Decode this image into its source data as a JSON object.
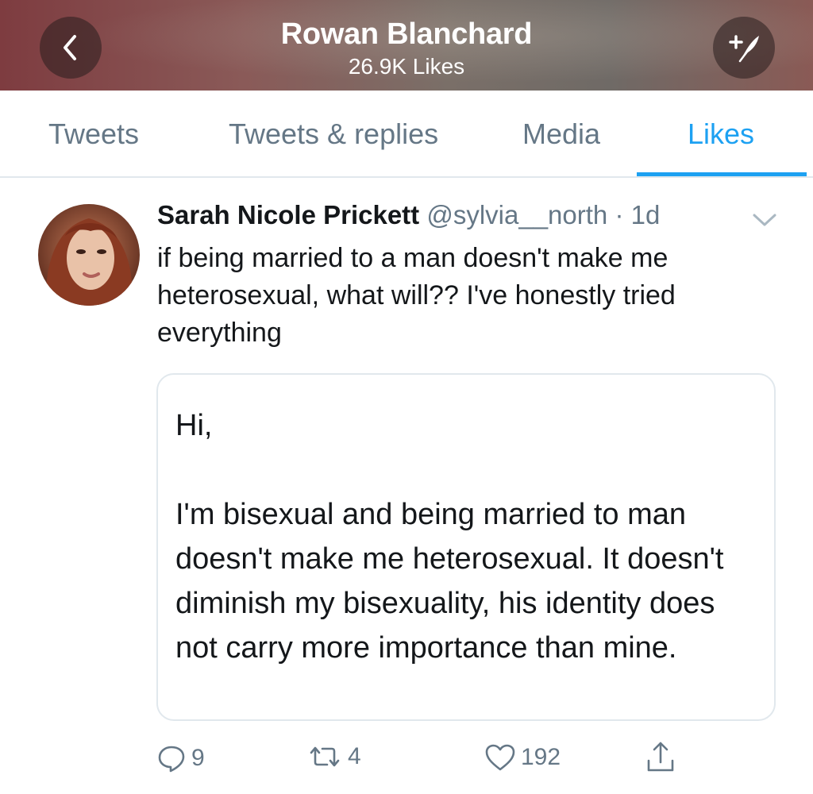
{
  "header": {
    "title": "Rowan Blanchard",
    "subtitle": "26.9K Likes",
    "back_icon": "chevron-left-icon",
    "compose_icon": "compose-tweet-icon"
  },
  "tabs": [
    {
      "label": "Tweets",
      "active": false
    },
    {
      "label": "Tweets & replies",
      "active": false
    },
    {
      "label": "Media",
      "active": false
    },
    {
      "label": "Likes",
      "active": true
    }
  ],
  "tweet": {
    "author_name": "Sarah Nicole Prickett",
    "author_handle": "@sylvia__north",
    "separator": "·",
    "time": "1d",
    "text": "if being married to a man doesn't make me heterosexual, what will?? I've honestly tried everything",
    "card": {
      "greeting": "Hi,",
      "body": "I'm bisexual and being married to man doesn't make me heterosexual. It doesn't diminish my bisexuality, his identity does not carry more importance than mine."
    },
    "actions": {
      "replies": "9",
      "retweets": "4",
      "likes": "192"
    }
  },
  "colors": {
    "accent": "#1da1f2",
    "muted": "#657786",
    "text": "#14171a"
  }
}
